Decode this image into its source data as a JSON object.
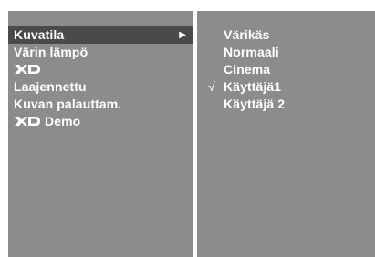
{
  "menu": {
    "items": [
      {
        "label": "Kuvatila",
        "selected": true,
        "submenu_arrow": "▶"
      },
      {
        "label": "Värin lämpö",
        "selected": false
      },
      {
        "label": "",
        "logo": "xd-logo-icon",
        "selected": false
      },
      {
        "label": "Laajennettu",
        "selected": false
      },
      {
        "label": "Kuvan palauttam.",
        "selected": false
      },
      {
        "label": "Demo",
        "logo": "xd-logo-icon",
        "selected": false
      }
    ]
  },
  "submenu": {
    "items": [
      {
        "label": "Värikäs",
        "checked": false
      },
      {
        "label": "Normaali",
        "checked": false
      },
      {
        "label": "Cinema",
        "checked": false
      },
      {
        "label": "Käyttäjä1",
        "checked": true,
        "check_mark": "√"
      },
      {
        "label": "Käyttäjä 2",
        "checked": false
      }
    ]
  },
  "colors": {
    "panel": "#8c8c8c",
    "selection": "#4a4a4a",
    "text": "#ffffff",
    "divider": "#ffffff"
  }
}
